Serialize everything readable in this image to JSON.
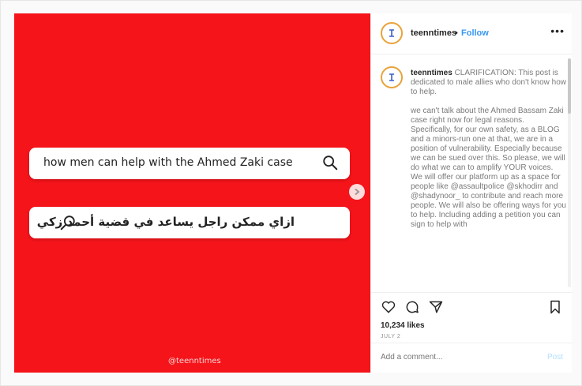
{
  "image": {
    "search_en": "how men can help with the Ahmed Zaki case",
    "search_ar": "ازاي ممكن راجل يساعد في قضية أحمد زكي",
    "watermark": "@teenntimes",
    "bg_color": "#f4141a"
  },
  "header": {
    "username": "teenntimes",
    "separator": "•",
    "follow": "Follow",
    "more": "•••"
  },
  "caption": {
    "username": "teenntimes",
    "p1": "CLARIFICATION: This post is dedicated to male allies who don't know how to help.",
    "p2": "we can't talk about the Ahmed Bassam Zaki case right now for legal reasons. Specifically, for our own safety, as a BLOG and a minors-run one at that, we are in a position of vulnerability. Especially because we can be sued over this. So please, we will do what we can to amplify YOUR voices. We will offer our platform up as a space for people like @assaultpolice @skhodirr and @shadynoor_ to contribute and reach more people. We will also be offering ways for you to help. Including adding a petition you can sign to help with"
  },
  "actions": {
    "likes": "10,234 likes",
    "date": "JULY 2"
  },
  "comment": {
    "placeholder": "Add a comment...",
    "post": "Post"
  }
}
